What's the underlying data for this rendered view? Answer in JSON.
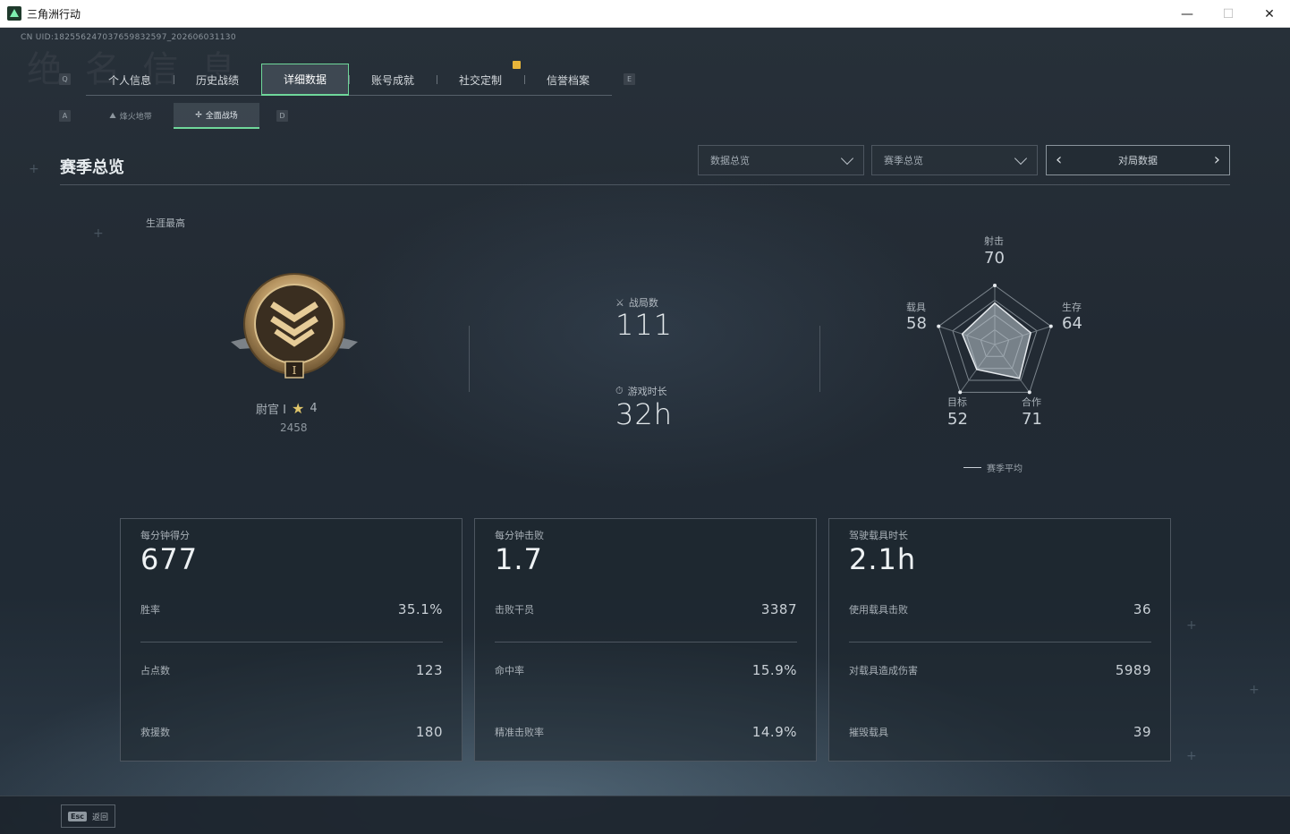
{
  "window": {
    "title": "三角洲行动",
    "minimize": "—",
    "maximize": "☐",
    "close": "✕"
  },
  "uid": "CN UID:18255624703765983259​7_202606031130",
  "key_hints": {
    "prev_tab": "Q",
    "next_tab": "E",
    "prev_sub": "A",
    "next_sub": "D"
  },
  "main_tabs": [
    {
      "label": "个人信息",
      "active": false
    },
    {
      "label": "历史战绩",
      "active": false
    },
    {
      "label": "详细数据",
      "active": true
    },
    {
      "label": "账号成就",
      "active": false
    },
    {
      "label": "社交定制",
      "active": false
    },
    {
      "label": "信誉档案",
      "active": false
    }
  ],
  "sub_tabs": [
    {
      "label": "烽火地带",
      "active": false
    },
    {
      "label": "全面战场",
      "active": true
    }
  ],
  "header": {
    "title": "赛季总览",
    "dropdown1": "数据总览",
    "dropdown2": "赛季总览",
    "pager_label": "对局数据"
  },
  "rank": {
    "career_label": "生涯最高",
    "name": "尉官 I",
    "stars": "4",
    "score": "2458"
  },
  "center": {
    "matches_label": "战局数",
    "matches_value": "111",
    "time_label": "游戏时长",
    "time_value": "32h"
  },
  "radar": {
    "axes": [
      {
        "label": "射击",
        "value": "70"
      },
      {
        "label": "生存",
        "value": "64"
      },
      {
        "label": "合作",
        "value": "71"
      },
      {
        "label": "目标",
        "value": "52"
      },
      {
        "label": "载具",
        "value": "58"
      }
    ],
    "legend": "赛季平均"
  },
  "cards": [
    {
      "title": "每分钟得分",
      "value": "677",
      "rows": [
        {
          "k": "胜率",
          "v": "35.1%"
        },
        {
          "k": "占点数",
          "v": "123"
        },
        {
          "k": "救援数",
          "v": "180"
        }
      ]
    },
    {
      "title": "每分钟击败",
      "value": "1.7",
      "rows": [
        {
          "k": "击败干员",
          "v": "3387"
        },
        {
          "k": "命中率",
          "v": "15.9%"
        },
        {
          "k": "精准击败率",
          "v": "14.9%"
        }
      ]
    },
    {
      "title": "驾驶载具时长",
      "value": "2.1h",
      "rows": [
        {
          "k": "使用载具击败",
          "v": "36"
        },
        {
          "k": "对载具造成伤害",
          "v": "5989"
        },
        {
          "k": "摧毁载具",
          "v": "39"
        }
      ]
    }
  ],
  "bottom": {
    "esc_key": "Esc",
    "esc_label": "返回"
  },
  "icons": [
    "triangle-app-icon",
    "crossed-swords-icon",
    "stopwatch-icon",
    "star-icon",
    "rank-medal-icon",
    "chevron-down-icon",
    "arrow-left-icon",
    "arrow-right-icon"
  ]
}
